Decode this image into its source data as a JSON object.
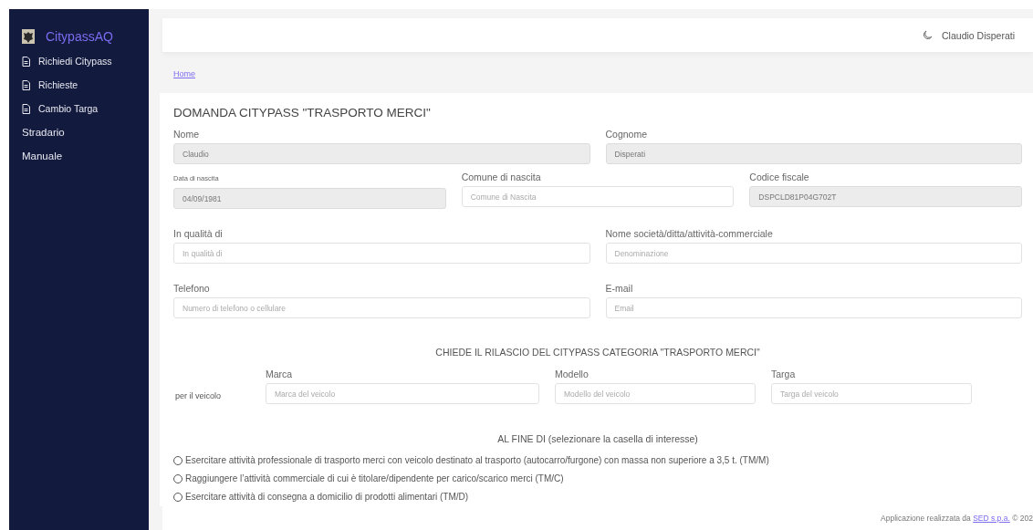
{
  "sidebar": {
    "brand": "CitypassAQ",
    "items": [
      {
        "label": "Richiedi Citypass",
        "icon": true
      },
      {
        "label": "Richieste",
        "icon": true
      },
      {
        "label": "Cambio Targa",
        "icon": true
      },
      {
        "label": "Stradario",
        "icon": false
      },
      {
        "label": "Manuale",
        "icon": false
      }
    ]
  },
  "header": {
    "user": "Claudio Disperati"
  },
  "breadcrumb": "Home",
  "form": {
    "title": "DOMANDA CITYPASS \"TRASPORTO MERCI\"",
    "rows": [
      [
        {
          "label": "Nome",
          "value": "Claudio",
          "readonly": true
        },
        {
          "label": "Cognome",
          "value": "Disperati",
          "readonly": true
        }
      ],
      [
        {
          "label": "Data di nascita",
          "small_label": true,
          "value": "04/09/1981",
          "readonly": true
        },
        {
          "label": "Comune di nascita",
          "placeholder": "Comune di Nascita",
          "readonly": false
        },
        {
          "label": "Codice fiscale",
          "value": "DSPCLD81P04G702T",
          "readonly": true
        }
      ],
      [
        {
          "label": "In qualità di",
          "placeholder": "In qualità di",
          "readonly": false
        },
        {
          "label": "Nome società/ditta/attività-commerciale",
          "placeholder": "Denominazione",
          "readonly": false
        }
      ],
      [
        {
          "label": "Telefono",
          "placeholder": "Numero di telefono o cellulare",
          "readonly": false
        },
        {
          "label": "E-mail",
          "placeholder": "Email",
          "readonly": false
        }
      ]
    ],
    "request_heading": "CHIEDE IL RILASCIO DEL CITYPASS CATEGORIA \"TRASPORTO MERCI\"",
    "vehicle": {
      "label": "per il veicolo",
      "fields": [
        {
          "label": "Marca",
          "placeholder": "Marca del veicolo"
        },
        {
          "label": "Modello",
          "placeholder": "Modello del veicolo"
        },
        {
          "label": "Targa",
          "placeholder": "Targa del veicolo"
        }
      ]
    },
    "purpose_heading": "AL FINE DI (selezionare la casella di interesse)",
    "options": [
      {
        "label": "Esercitare attività professionale di trasporto merci con veicolo destinato al trasporto (autocarro/furgone) con massa non superiore a 3,5 t. (TM/M)",
        "selected": false
      },
      {
        "label": "Raggiungere l’attività commerciale di cui è titolare/dipendente per carico/scarico merci (TM/C)",
        "selected": false
      },
      {
        "label": "Esercitare attività di consegna a domicilio di prodotti alimentari (TM/D)",
        "selected": false
      }
    ]
  },
  "footer": {
    "text": "Applicazione realizzata da",
    "link": "SED s.p.a.",
    "suffix": "© 202"
  }
}
